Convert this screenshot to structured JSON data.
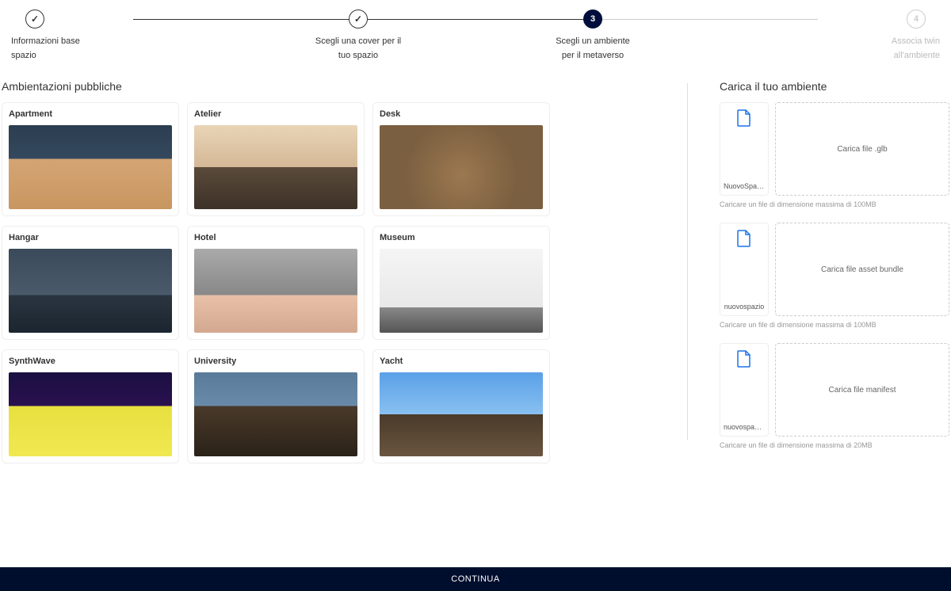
{
  "stepper": {
    "steps": [
      {
        "label": "Informazioni base spazio",
        "state": "done"
      },
      {
        "label": "Scegli una cover per il tuo spazio",
        "state": "done"
      },
      {
        "num": "3",
        "label": "Scegli un ambiente per il metaverso",
        "state": "active"
      },
      {
        "num": "4",
        "label": "Associa twin all'ambiente",
        "state": "future"
      }
    ]
  },
  "left": {
    "heading": "Ambientazioni pubbliche",
    "cards": [
      {
        "title": "Apartment"
      },
      {
        "title": "Atelier"
      },
      {
        "title": "Desk"
      },
      {
        "title": "Hangar"
      },
      {
        "title": "Hotel"
      },
      {
        "title": "Museum"
      },
      {
        "title": "SynthWave"
      },
      {
        "title": "University"
      },
      {
        "title": "Yacht"
      }
    ]
  },
  "right": {
    "heading": "Carica il tuo ambiente",
    "uploads": [
      {
        "fileName": "NuovoSpazio...",
        "dropLabel": "Carica file .glb",
        "hint": "Caricare un file di dimensione massima di 100MB"
      },
      {
        "fileName": "nuovospazio",
        "dropLabel": "Carica file asset bundle",
        "hint": "Caricare un file di dimensione massima di 100MB"
      },
      {
        "fileName": "nuovospazio....",
        "dropLabel": "Carica file manifest",
        "hint": "Caricare un file di dimensione massima di 20MB"
      }
    ]
  },
  "footer": {
    "continueLabel": "CONTINUA"
  }
}
